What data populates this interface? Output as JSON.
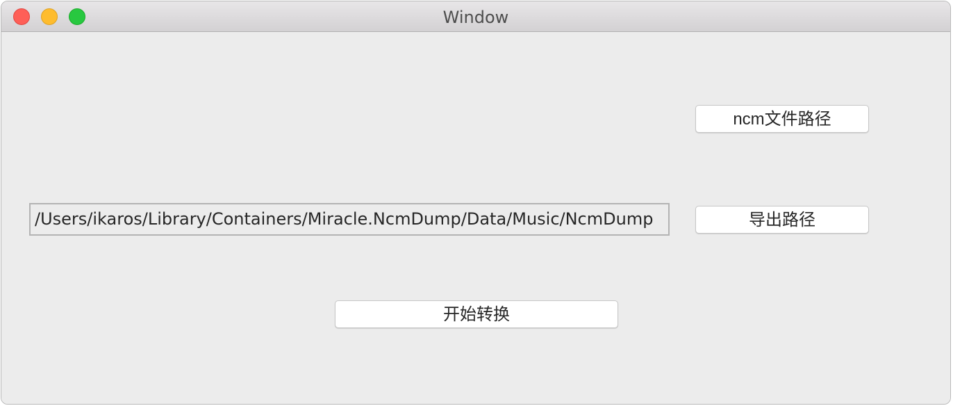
{
  "window": {
    "title": "Window"
  },
  "buttons": {
    "ncm_path_label": "ncm文件路径",
    "export_path_label": "导出路径",
    "start_convert_label": "开始转换"
  },
  "export_path": {
    "value": "/Users/ikaros/Library/Containers/Miracle.NcmDump/Data/Music/NcmDump"
  },
  "colors": {
    "close": "#fe5f57",
    "minimize": "#febc2e",
    "zoom": "#28c840",
    "background": "#ececec"
  }
}
